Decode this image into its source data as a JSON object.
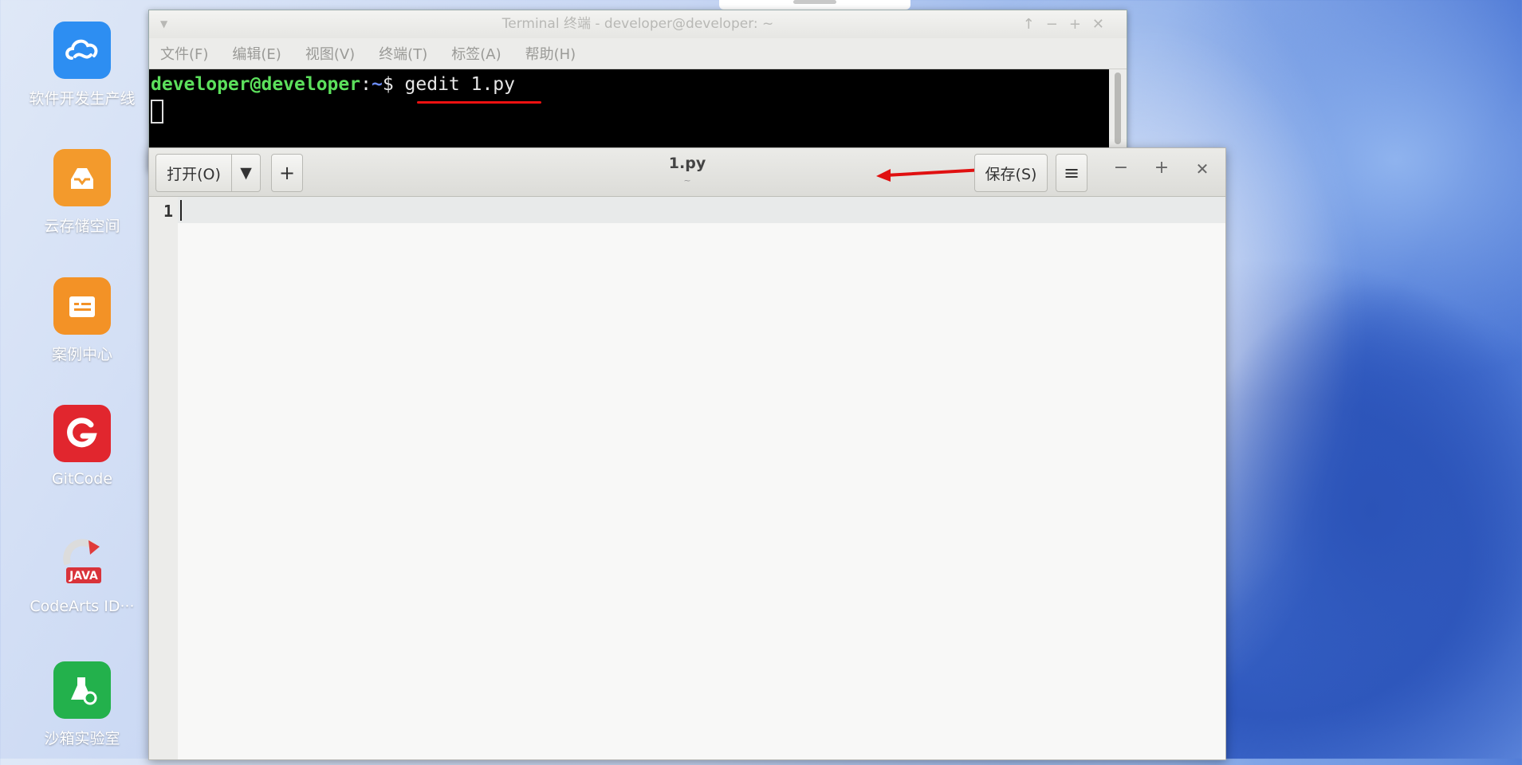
{
  "desktop": {
    "icons": [
      {
        "label": "软件开发生产线",
        "color": "#2f8ff0",
        "icon": "cloud-flow-icon"
      },
      {
        "label": "云存储空间",
        "color": "#f29a2e",
        "icon": "cloud-storage-icon"
      },
      {
        "label": "案例中心",
        "color": "#f39224",
        "icon": "case-center-icon"
      },
      {
        "label": "GitCode",
        "color": "#e3262c",
        "icon": "gitcode-icon"
      },
      {
        "label": "CodeArts ID···",
        "color": "#d9333a",
        "icon": "java-ide-icon"
      },
      {
        "label": "沙箱实验室",
        "color": "#22b04b",
        "icon": "sandbox-lab-icon"
      }
    ]
  },
  "terminal": {
    "title": "Terminal 终端 - developer@developer: ~",
    "menu": [
      "文件(F)",
      "编辑(E)",
      "视图(V)",
      "终端(T)",
      "标签(A)",
      "帮助(H)"
    ],
    "prompt_user": "developer@developer",
    "prompt_sep": ":",
    "prompt_path": "~",
    "prompt_dollar": "$ ",
    "command": "gedit 1.py"
  },
  "gedit": {
    "open_label": "打开(O)",
    "new_tab_label": "+",
    "title": "1.py",
    "subtitle": "~",
    "save_label": "保存(S)",
    "menu_label": "≡",
    "minimize": "−",
    "maximize": "+",
    "close": "✕",
    "line_numbers": [
      "1"
    ]
  },
  "colors": {
    "annotation": "#e01010"
  }
}
